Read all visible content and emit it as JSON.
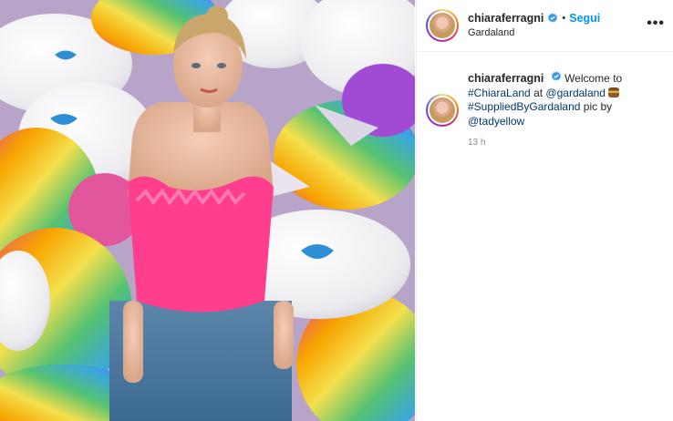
{
  "post": {
    "username": "chiaraferragni",
    "follow_label": "Segui",
    "separator": "•",
    "location": "Gardaland",
    "more_label": "•••"
  },
  "caption": {
    "username": "chiaraferragni",
    "text_1": "Welcome to",
    "hashtag_1": "#ChiaraLand",
    "at_word": "at",
    "mention_1": "@gardaland",
    "hashtag_2": "#SuppliedByGardaland",
    "text_2": "pic by",
    "mention_2": "@tadyellow",
    "emoji": "pancake-emoji",
    "time": "13 h"
  },
  "icons": {
    "verified": "verified-badge-icon",
    "more": "more-options-icon"
  },
  "colors": {
    "link_blue": "#0095f6",
    "hashtag": "#00376b",
    "muted": "#8e8e8e"
  }
}
